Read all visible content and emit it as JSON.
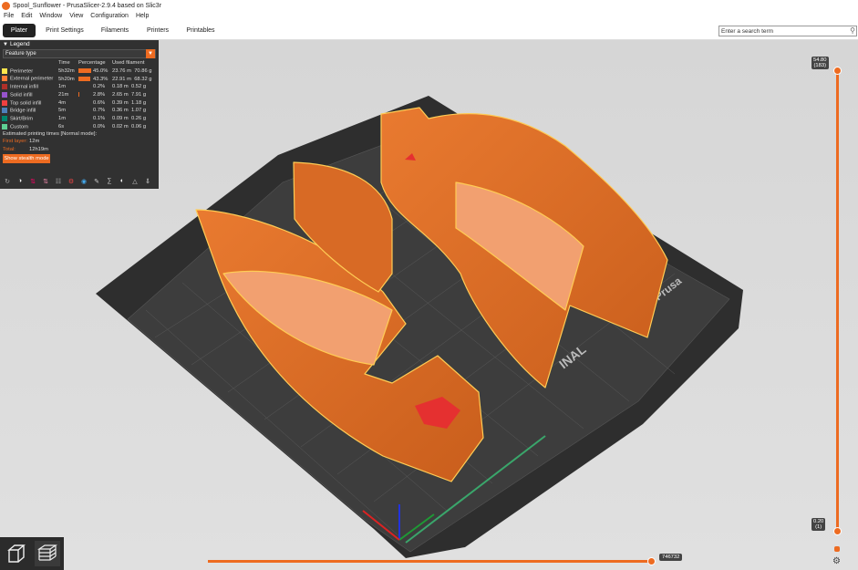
{
  "window": {
    "title": "Spool_Sunflower - PrusaSlicer-2.9.4 based on Slic3r"
  },
  "menu": [
    "File",
    "Edit",
    "Window",
    "View",
    "Configuration",
    "Help"
  ],
  "tabs": [
    {
      "label": "Plater"
    },
    {
      "label": "Print Settings"
    },
    {
      "label": "Filaments"
    },
    {
      "label": "Printers"
    },
    {
      "label": "Printables"
    }
  ],
  "search": {
    "placeholder": "Enter a search term"
  },
  "legend": {
    "header": "Legend",
    "view_type": "Feature type",
    "columns": {
      "time": "Time",
      "percentage": "Percentage",
      "used": "Used filament"
    },
    "rows": [
      {
        "name": "Perimeter",
        "color": "#ffe64d",
        "time": "5h32m",
        "pct": "45.0%",
        "pct_value": 45.0,
        "length": "23.76 m",
        "weight": "70.86 g"
      },
      {
        "name": "External perimeter",
        "color": "#ff7d38",
        "time": "5h20m",
        "pct": "43.3%",
        "pct_value": 43.3,
        "length": "22.91 m",
        "weight": "68.32 g"
      },
      {
        "name": "Internal infill",
        "color": "#b03029",
        "time": "1m",
        "pct": "0.2%",
        "pct_value": 0.2,
        "length": "0.18 m",
        "weight": "0.52 g"
      },
      {
        "name": "Solid infill",
        "color": "#9654cc",
        "time": "21m",
        "pct": "2.8%",
        "pct_value": 2.8,
        "length": "2.65 m",
        "weight": "7.91 g"
      },
      {
        "name": "Top solid infill",
        "color": "#f04040",
        "time": "4m",
        "pct": "0.6%",
        "pct_value": 0.6,
        "length": "0.39 m",
        "weight": "1.18 g"
      },
      {
        "name": "Bridge infill",
        "color": "#4d80ba",
        "time": "5m",
        "pct": "0.7%",
        "pct_value": 0.7,
        "length": "0.36 m",
        "weight": "1.07 g"
      },
      {
        "name": "Skirt/Brim",
        "color": "#00876e",
        "time": "1m",
        "pct": "0.1%",
        "pct_value": 0.1,
        "length": "0.09 m",
        "weight": "0.26 g"
      },
      {
        "name": "Custom",
        "color": "#5ed194",
        "time": "6s",
        "pct": "0.0%",
        "pct_value": 0.0,
        "length": "0.02 m",
        "weight": "0.06 g"
      }
    ],
    "estimated_label": "Estimated printing times [Normal mode]:",
    "first_layer_label": "First layer:",
    "first_layer_value": "12m",
    "total_label": "Total:",
    "total_value": "12h19m",
    "stealth_button": "Show stealth mode"
  },
  "layer_slider": {
    "top_height": "54.80",
    "top_layer": "(183)",
    "bottom_height": "0.20",
    "bottom_layer": "(1)"
  },
  "move_slider": {
    "value": "746732"
  },
  "bed": {
    "brand": "Prusa",
    "text_partial": "INAL"
  },
  "colors": {
    "accent": "#ed6b21",
    "model": "#e3722a",
    "bed": "#2e2e2e"
  }
}
